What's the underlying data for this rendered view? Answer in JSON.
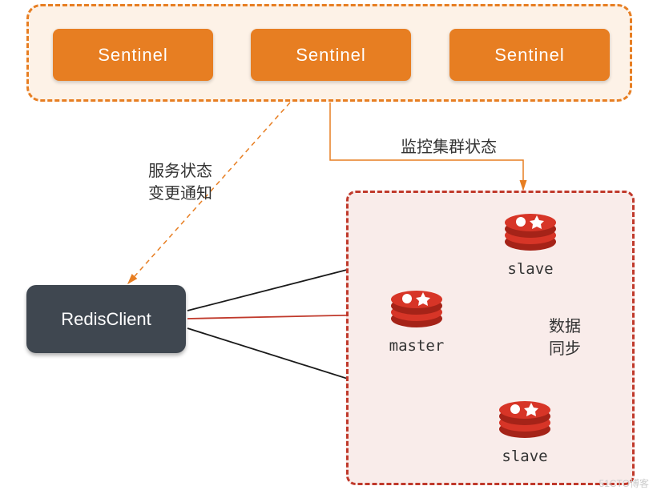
{
  "sentinels": {
    "box1": "Sentinel",
    "box2": "Sentinel",
    "box3": "Sentinel"
  },
  "client": {
    "label": "RedisClient"
  },
  "cluster": {
    "master": "master",
    "slave1": "slave",
    "slave2": "slave"
  },
  "edges": {
    "notify_line1": "服务状态",
    "notify_line2": "变更通知",
    "monitor": "监控集群状态",
    "sync_line1": "数据",
    "sync_line2": "同步"
  },
  "colors": {
    "sentinel_border": "#e77e22",
    "sentinel_fill": "#fdf2e7",
    "sentinel_box": "#e77e22",
    "client_box": "#3f4750",
    "cluster_border": "#c0392b",
    "cluster_fill": "#f9ecea",
    "redis_red": "#d73527"
  },
  "watermark": "51CTO博客"
}
